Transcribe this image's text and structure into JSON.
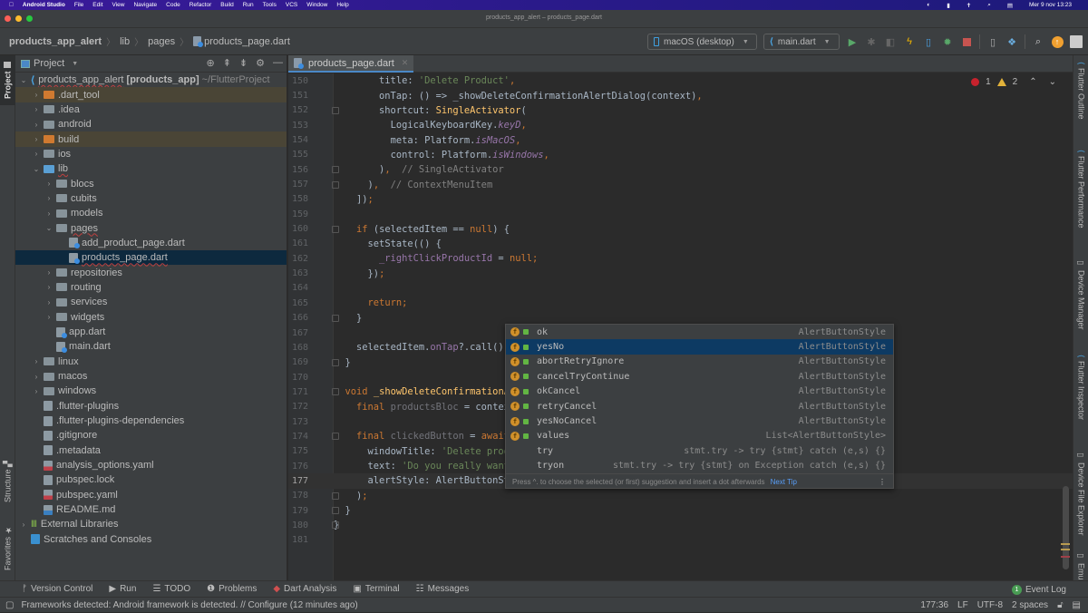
{
  "mac_menubar": {
    "app_name": "Android Studio",
    "menus": [
      "File",
      "Edit",
      "View",
      "Navigate",
      "Code",
      "Refactor",
      "Build",
      "Run",
      "Tools",
      "VCS",
      "Window",
      "Help"
    ],
    "clock": "Mer 9 nov  13:23"
  },
  "window": {
    "title": "products_app_alert – products_page.dart"
  },
  "breadcrumb": {
    "items": [
      "products_app_alert",
      "lib",
      "pages",
      "products_page.dart"
    ]
  },
  "toolbar": {
    "device_selector": "macOS (desktop)",
    "run_config": "main.dart"
  },
  "left_tool_tabs": {
    "project": "Project",
    "structure": "Structure",
    "favorites": "Favorites"
  },
  "right_tool_tabs": [
    "Flutter Outline",
    "Flutter Performance",
    "Device Manager",
    "Flutter Inspector",
    "Device File Explorer",
    "Emulator"
  ],
  "project_panel": {
    "title": "Project",
    "root": {
      "name": "products_app_alert",
      "module": "[products_app]",
      "path": "~/FlutterProject"
    },
    "tree": [
      {
        "label": ".dart_tool",
        "indent": 1,
        "kind": "folder-orange",
        "expand": ">",
        "excluded": true
      },
      {
        "label": ".idea",
        "indent": 1,
        "kind": "folder",
        "expand": ">"
      },
      {
        "label": "android",
        "indent": 1,
        "kind": "folder",
        "expand": ">"
      },
      {
        "label": "build",
        "indent": 1,
        "kind": "folder-orange",
        "expand": ">",
        "excluded": true
      },
      {
        "label": "ios",
        "indent": 1,
        "kind": "folder",
        "expand": ">"
      },
      {
        "label": "lib",
        "indent": 1,
        "kind": "folder-lib",
        "expand": "v"
      },
      {
        "label": "blocs",
        "indent": 2,
        "kind": "folder",
        "expand": ">"
      },
      {
        "label": "cubits",
        "indent": 2,
        "kind": "folder",
        "expand": ">"
      },
      {
        "label": "models",
        "indent": 2,
        "kind": "folder",
        "expand": ">"
      },
      {
        "label": "pages",
        "indent": 2,
        "kind": "folder",
        "expand": "v"
      },
      {
        "label": "add_product_page.dart",
        "indent": 3,
        "kind": "dart",
        "expand": ""
      },
      {
        "label": "products_page.dart",
        "indent": 3,
        "kind": "dart",
        "expand": "",
        "selected": true
      },
      {
        "label": "repositories",
        "indent": 2,
        "kind": "folder",
        "expand": ">"
      },
      {
        "label": "routing",
        "indent": 2,
        "kind": "folder",
        "expand": ">"
      },
      {
        "label": "services",
        "indent": 2,
        "kind": "folder",
        "expand": ">"
      },
      {
        "label": "widgets",
        "indent": 2,
        "kind": "folder",
        "expand": ">"
      },
      {
        "label": "app.dart",
        "indent": 2,
        "kind": "dart",
        "expand": ""
      },
      {
        "label": "main.dart",
        "indent": 2,
        "kind": "dart",
        "expand": ""
      },
      {
        "label": "linux",
        "indent": 1,
        "kind": "folder",
        "expand": ">"
      },
      {
        "label": "macos",
        "indent": 1,
        "kind": "folder",
        "expand": ">"
      },
      {
        "label": "windows",
        "indent": 1,
        "kind": "folder",
        "expand": ">"
      },
      {
        "label": ".flutter-plugins",
        "indent": 1,
        "kind": "file",
        "expand": ""
      },
      {
        "label": ".flutter-plugins-dependencies",
        "indent": 1,
        "kind": "file",
        "expand": ""
      },
      {
        "label": ".gitignore",
        "indent": 1,
        "kind": "file",
        "expand": ""
      },
      {
        "label": ".metadata",
        "indent": 1,
        "kind": "file",
        "expand": ""
      },
      {
        "label": "analysis_options.yaml",
        "indent": 1,
        "kind": "yaml",
        "expand": ""
      },
      {
        "label": "pubspec.lock",
        "indent": 1,
        "kind": "file",
        "expand": ""
      },
      {
        "label": "pubspec.yaml",
        "indent": 1,
        "kind": "yaml",
        "expand": ""
      },
      {
        "label": "README.md",
        "indent": 1,
        "kind": "md",
        "expand": ""
      },
      {
        "label": "External Libraries",
        "indent": 0,
        "kind": "libs",
        "expand": ">"
      },
      {
        "label": "Scratches and Consoles",
        "indent": 0,
        "kind": "scratch",
        "expand": ""
      }
    ]
  },
  "editor": {
    "tab": "products_page.dart",
    "inspection": {
      "errors": "1",
      "warnings": "2"
    },
    "current_line": 177,
    "lines": [
      {
        "n": 150,
        "html": "        <span class='pl'>title: </span><span class='str'>'Delete Product'</span><span class='kw'>,</span>"
      },
      {
        "n": 151,
        "html": "        <span class='pl'>onTap: () => _showDeleteConfirmationAlertDialog(context)</span><span class='kw'>,</span>"
      },
      {
        "n": 152,
        "html": "        <span class='pl'>shortcut: </span><span class='cls'>SingleActivator</span><span class='pl'>(</span>"
      },
      {
        "n": 153,
        "html": "          <span class='pl'>LogicalKeyboardKey.</span><span class='ital'>keyD</span><span class='kw'>,</span>"
      },
      {
        "n": 154,
        "html": "          <span class='pl'>meta: Platform.</span><span class='ital'>isMacOS</span><span class='kw'>,</span>"
      },
      {
        "n": 155,
        "html": "          <span class='pl'>control: Platform.</span><span class='ital'>isWindows</span><span class='kw'>,</span>"
      },
      {
        "n": 156,
        "html": "        <span class='pl'>)</span><span class='kw'>,</span>  <span class='cm'>// SingleActivator</span>"
      },
      {
        "n": 157,
        "html": "      <span class='pl'>)</span><span class='kw'>,</span>  <span class='cm'>// ContextMenuItem</span>"
      },
      {
        "n": 158,
        "html": "    <span class='pl'>])</span><span class='kw'>;</span>"
      },
      {
        "n": 159,
        "html": ""
      },
      {
        "n": 160,
        "html": "    <span class='kw'>if</span> <span class='pl'>(selectedItem == </span><span class='kw'>null</span><span class='pl'>) {</span>"
      },
      {
        "n": 161,
        "html": "      <span class='pl'>setState(() {</span>"
      },
      {
        "n": 162,
        "html": "        <span class='fld'>_rightClickProductId</span><span class='pl'> = </span><span class='kw'>null;</span>"
      },
      {
        "n": 163,
        "html": "      <span class='pl'>})</span><span class='kw'>;</span>"
      },
      {
        "n": 164,
        "html": ""
      },
      {
        "n": 165,
        "html": "      <span class='kw'>return;</span>"
      },
      {
        "n": 166,
        "html": "    <span class='pl'>}</span>"
      },
      {
        "n": 167,
        "html": ""
      },
      {
        "n": 168,
        "html": "    <span class='pl'>selectedItem.</span><span class='fld'>onTap</span><span class='pl'>?.call()</span><span class='kw'>;</span>"
      },
      {
        "n": 169,
        "html": "  <span class='pl'>}</span>"
      },
      {
        "n": 170,
        "html": ""
      },
      {
        "n": 171,
        "html": "  <span class='kw'>void</span> <span class='fn'>_showDeleteConfirmationAlertDialog</span><span class='pl'>(BuildContext context) </span><span class='kw'>async</span><span class='pl'> {</span>"
      },
      {
        "n": 172,
        "html": "    <span class='kw'>final</span> <span class='dim'>productsBloc</span><span class='pl'> = context.read&lt;ProductsBloc&gt;()</span><span class='kw'>;</span>"
      },
      {
        "n": 173,
        "html": ""
      },
      {
        "n": 174,
        "html": "    <span class='kw'>final</span> <span class='dim'>clickedButton</span><span class='pl'> = </span><span class='kw'>await</span><span class='pl'> FlutterPlatformAlert.showAlert(</span>"
      },
      {
        "n": 175,
        "html": "      <span class='pl'>windowTitle: </span><span class='str'>'Delete product'</span><span class='kw'>,</span>"
      },
      {
        "n": 176,
        "html": "      <span class='pl'>text: </span><span class='str'>'Do you really want to delete this product?'</span><span class='kw'>,</span>"
      },
      {
        "n": 177,
        "html": "      <span class='pl'>alertStyle: AlertButtonStyle.</span><span class='cursor'></span>"
      },
      {
        "n": 178,
        "html": "    <span class='pl'>)</span><span class='kw'>;</span>"
      },
      {
        "n": 179,
        "html": "  <span class='pl'>}</span>"
      },
      {
        "n": 180,
        "html": "<span class='pl'>}</span>"
      },
      {
        "n": 181,
        "html": ""
      }
    ]
  },
  "completion_popup": {
    "selected_index": 1,
    "items": [
      {
        "name": "ok",
        "type": "AlertButtonStyle",
        "icon": "field"
      },
      {
        "name": "yesNo",
        "type": "AlertButtonStyle",
        "icon": "field"
      },
      {
        "name": "abortRetryIgnore",
        "type": "AlertButtonStyle",
        "icon": "field"
      },
      {
        "name": "cancelTryContinue",
        "type": "AlertButtonStyle",
        "icon": "field"
      },
      {
        "name": "okCancel",
        "type": "AlertButtonStyle",
        "icon": "field"
      },
      {
        "name": "retryCancel",
        "type": "AlertButtonStyle",
        "icon": "field"
      },
      {
        "name": "yesNoCancel",
        "type": "AlertButtonStyle",
        "icon": "field"
      },
      {
        "name": "values",
        "type": "List<AlertButtonStyle>",
        "icon": "field"
      },
      {
        "name": "try",
        "type": "stmt.try -> try {stmt} catch (e,s) {}",
        "icon": "none"
      },
      {
        "name": "tryon",
        "type": "stmt.try -> try {stmt} on Exception catch (e,s) {}",
        "icon": "none"
      }
    ],
    "footer_hint": "Press ^. to choose the selected (or first) suggestion and insert a dot afterwards",
    "footer_link": "Next Tip"
  },
  "bottom_tools": [
    "Version Control",
    "Run",
    "TODO",
    "Problems",
    "Dart Analysis",
    "Terminal",
    "Messages"
  ],
  "event_log": {
    "label": "Event Log",
    "count": "1"
  },
  "status": {
    "message": "Frameworks detected: Android framework is detected. // Configure (12 minutes ago)",
    "position": "177:36",
    "line_sep": "LF",
    "encoding": "UTF-8",
    "indent": "2 spaces"
  },
  "colors": {
    "accent": "#4a88c7",
    "selection": "#0d293e",
    "popup_selection": "#0d3a63",
    "error": "#c7222d",
    "warning": "#e2b23a",
    "run_green": "#59a869"
  }
}
